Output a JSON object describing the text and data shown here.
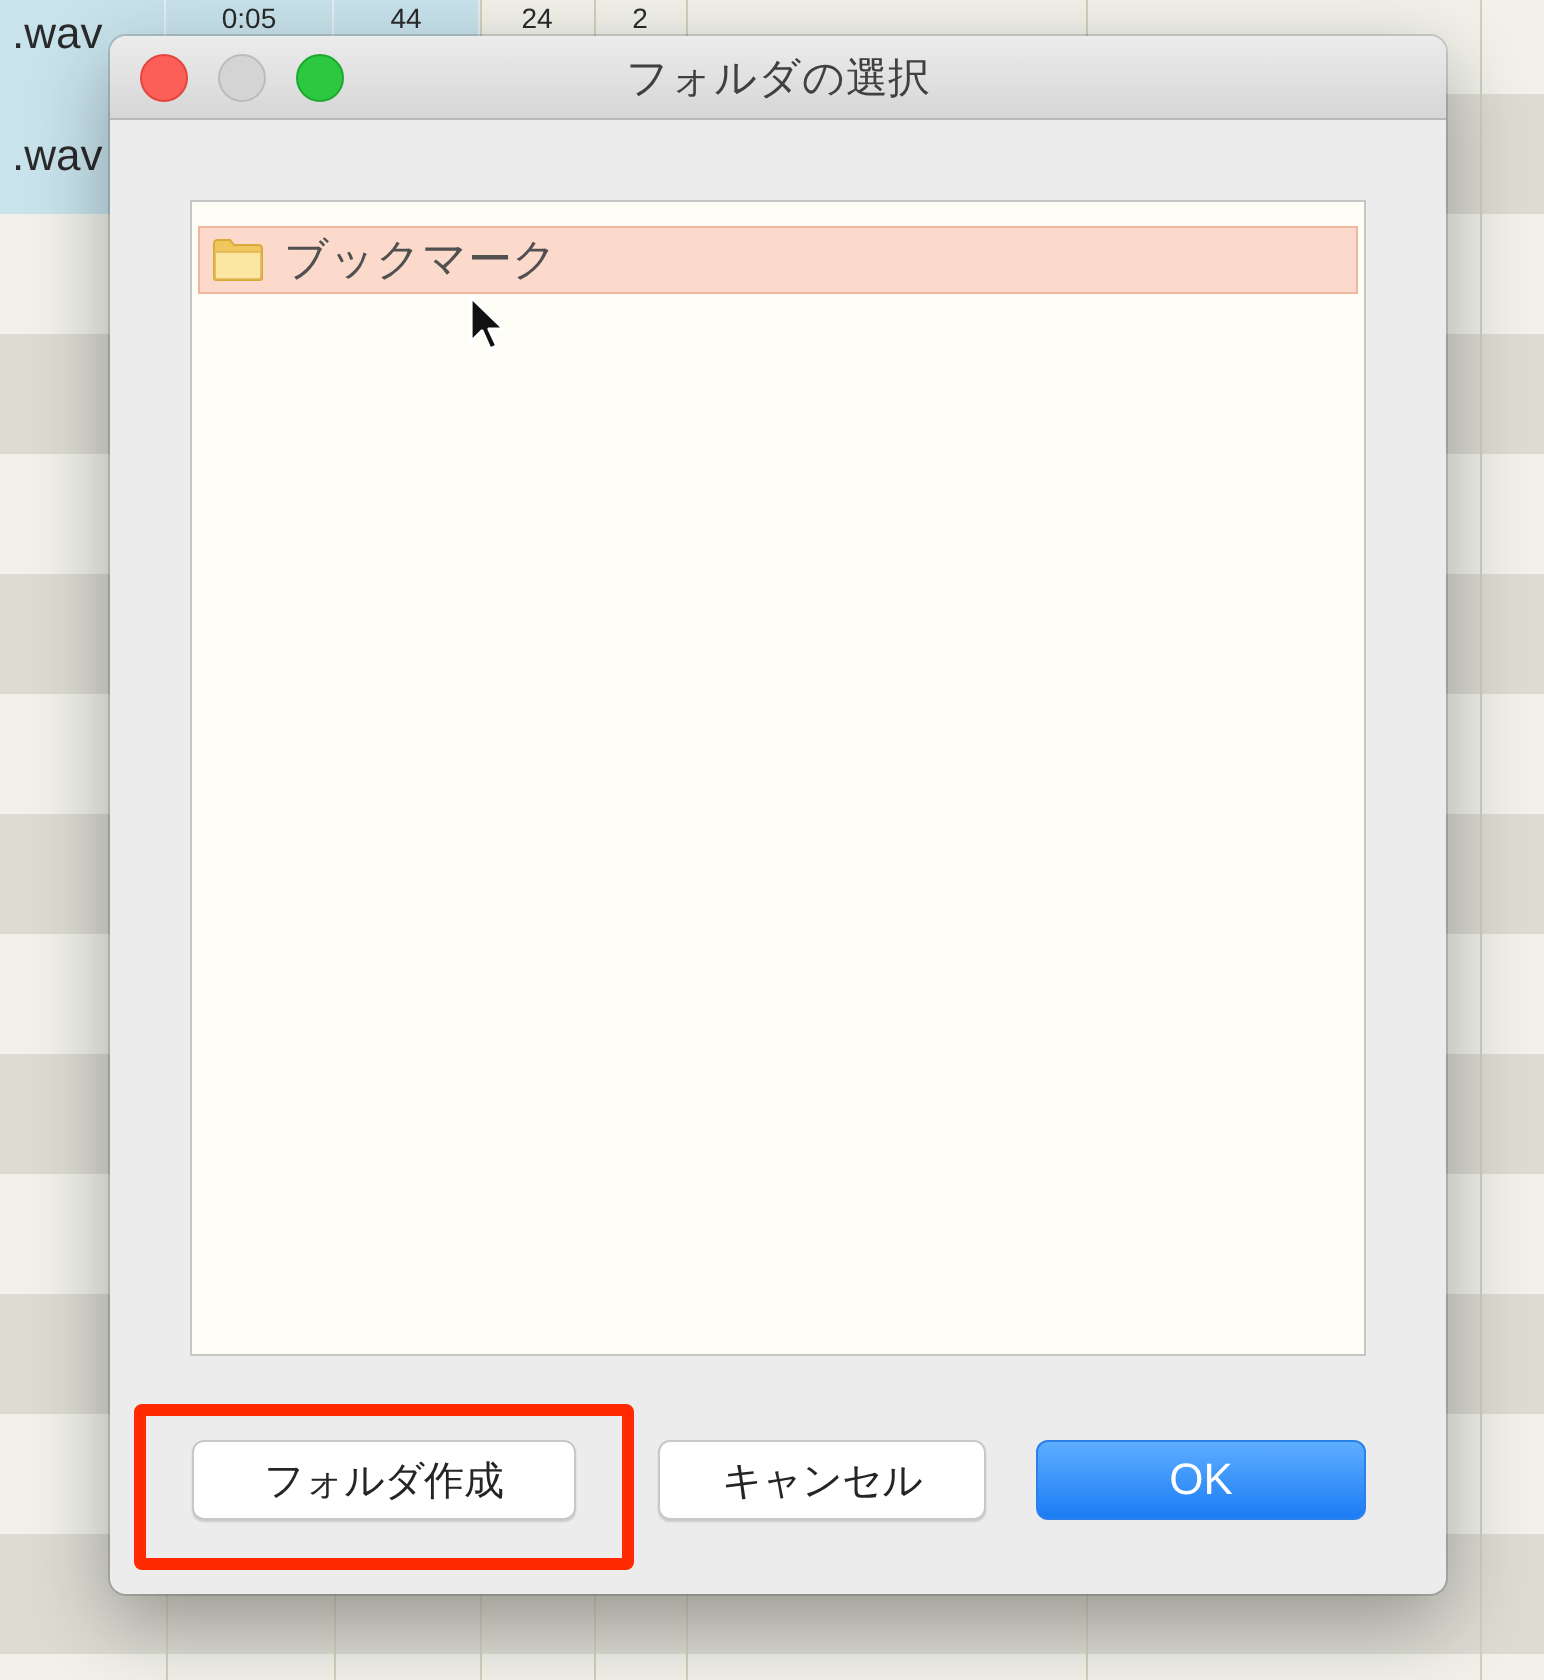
{
  "background_table": {
    "rows": [
      {
        "selected": true,
        "cells": [
          ".wav",
          "0:05",
          "44",
          "24",
          "2"
        ]
      },
      {
        "selected": true,
        "cells": [
          ".wav"
        ]
      }
    ]
  },
  "dialog": {
    "title": "フォルダの選択",
    "window_controls": [
      {
        "kind": "close",
        "disabled": false
      },
      {
        "kind": "minimize",
        "disabled": true
      },
      {
        "kind": "zoom",
        "disabled": false
      }
    ],
    "folder_list": {
      "items": [
        {
          "label": "ブックマーク",
          "selected": true
        }
      ]
    },
    "buttons": [
      {
        "label": "フォルダ作成",
        "kind": "plain",
        "highlighted": true
      },
      {
        "label": "キャンセル",
        "kind": "plain",
        "highlighted": false
      },
      {
        "label": "OK",
        "kind": "primary",
        "highlighted": false
      }
    ]
  }
}
